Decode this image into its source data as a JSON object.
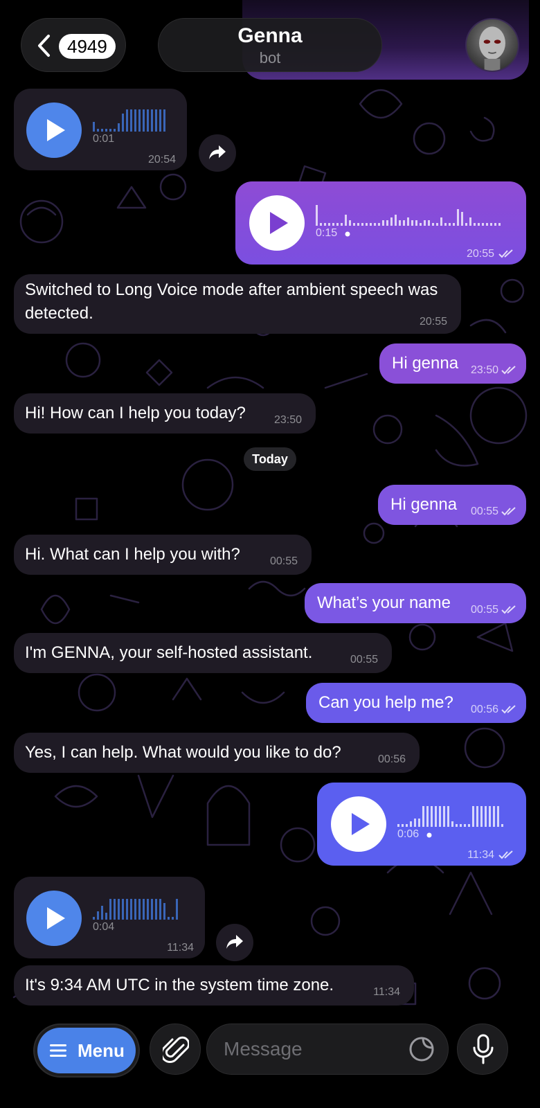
{
  "header": {
    "back_count": "4949",
    "title": "Genna",
    "subtitle": "bot"
  },
  "messages": [
    {
      "kind": "voice",
      "dir": "in",
      "duration": "0:01",
      "time": "20:54"
    },
    {
      "kind": "voice",
      "dir": "out",
      "duration": "0:15",
      "time": "20:55"
    },
    {
      "kind": "text",
      "dir": "in",
      "text": "Switched to Long Voice mode after ambient speech was detected.",
      "time": "20:55"
    },
    {
      "kind": "text",
      "dir": "out",
      "text": "Hi genna",
      "time": "23:50"
    },
    {
      "kind": "text",
      "dir": "in",
      "text": "Hi! How can I help you today?",
      "time": "23:50"
    },
    {
      "kind": "text",
      "dir": "out",
      "text": "Hi genna",
      "time": "00:55"
    },
    {
      "kind": "text",
      "dir": "in",
      "text": "Hi. What can I help you with?",
      "time": "00:55"
    },
    {
      "kind": "text",
      "dir": "out",
      "text": "What’s your name",
      "time": "00:55"
    },
    {
      "kind": "text",
      "dir": "in",
      "text": "I'm GENNA, your self-hosted assistant.",
      "time": "00:55"
    },
    {
      "kind": "text",
      "dir": "out",
      "text": "Can you help me?",
      "time": "00:56"
    },
    {
      "kind": "text",
      "dir": "in",
      "text": "Yes, I can help. What would you like to do?",
      "time": "00:56"
    },
    {
      "kind": "voice",
      "dir": "out",
      "duration": "0:06",
      "time": "11:34"
    },
    {
      "kind": "voice",
      "dir": "in",
      "duration": "0:04",
      "time": "11:34"
    },
    {
      "kind": "text",
      "dir": "in",
      "text": "It's 9:34 AM UTC in the system time zone.",
      "time": "11:34"
    }
  ],
  "date_separator": "Today",
  "composer": {
    "menu_label": "Menu",
    "placeholder": "Message"
  },
  "colors": {
    "background": "#000000",
    "incoming_bubble": "#1f1b25",
    "outgoing_bubble_top": "#8f4fd6",
    "outgoing_bubble_bottom": "#5b5ff0",
    "accent_blue": "#4f86ea"
  },
  "icons": {
    "back": "chevron-left-icon",
    "share": "share-arrow-icon",
    "play": "play-icon",
    "menu": "hamburger-icon",
    "attach": "paperclip-icon",
    "sticker": "sticker-icon",
    "mic": "microphone-icon"
  }
}
